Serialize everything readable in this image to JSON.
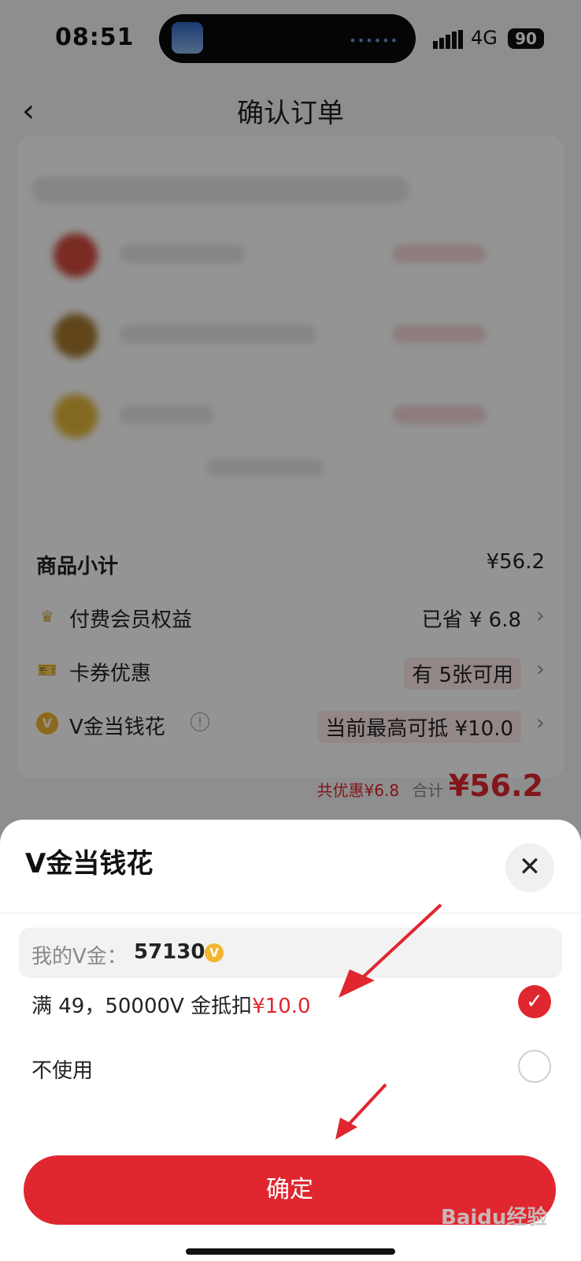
{
  "status_bar": {
    "time": "08:51",
    "network": "4G",
    "battery": "90"
  },
  "nav": {
    "back_icon": "chevron-left-icon",
    "title": "确认订单"
  },
  "order": {
    "subtotal_label": "商品小计",
    "subtotal_value": "¥56.2",
    "member_label": "付费会员权益",
    "member_value": "已省 ¥ 6.8",
    "coupon_label": "卡券优惠",
    "coupon_value": "有 5张可用",
    "vgold_label": "V金当钱花",
    "vgold_value": "当前最高可抵 ¥10.0",
    "total_discount": "共优惠¥6.8",
    "total_label": "合计",
    "total_value": "¥56.2"
  },
  "sheet": {
    "title": "V金当钱花",
    "balance_label": "我的V金：",
    "balance_value": "57130",
    "coin_icon_glyph": "V",
    "option1_text": "满 49，50000V 金抵扣",
    "option1_amount": "¥10.0",
    "option2_text": "不使用",
    "confirm_label": "确定"
  },
  "watermark": "Baidu经验",
  "colors": {
    "accent": "#e0262f",
    "coin": "#f2b630"
  }
}
